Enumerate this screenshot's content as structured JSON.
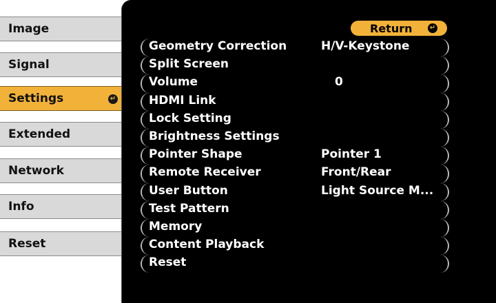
{
  "tabs": [
    {
      "label": "Image",
      "selected": false
    },
    {
      "label": "Signal",
      "selected": false
    },
    {
      "label": "Settings",
      "selected": true
    },
    {
      "label": "Extended",
      "selected": false
    },
    {
      "label": "Network",
      "selected": false
    },
    {
      "label": "Info",
      "selected": false
    },
    {
      "label": "Reset",
      "selected": false
    }
  ],
  "return_label": "Return",
  "enter_icon": "enter-icon",
  "items": [
    {
      "label": "Geometry Correction",
      "value": "H/V-Keystone"
    },
    {
      "label": "Split Screen",
      "value": ""
    },
    {
      "label": "Volume",
      "value": "0"
    },
    {
      "label": "HDMI Link",
      "value": ""
    },
    {
      "label": "Lock Setting",
      "value": ""
    },
    {
      "label": "Brightness Settings",
      "value": ""
    },
    {
      "label": "Pointer Shape",
      "value": "Pointer 1"
    },
    {
      "label": "Remote Receiver",
      "value": "Front/Rear"
    },
    {
      "label": "User Button",
      "value": "Light Source M..."
    },
    {
      "label": "Test Pattern",
      "value": ""
    },
    {
      "label": "Memory",
      "value": ""
    },
    {
      "label": "Content Playback",
      "value": ""
    },
    {
      "label": "Reset",
      "value": ""
    }
  ],
  "colors": {
    "highlight": "#f2b23a",
    "panel": "#000000",
    "tab": "#d9d9d9"
  }
}
